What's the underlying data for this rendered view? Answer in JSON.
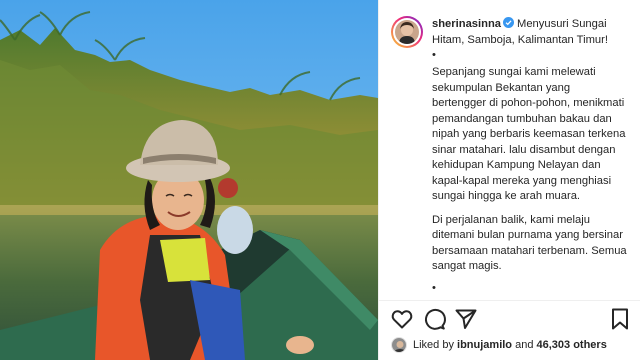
{
  "post": {
    "username": "sherinasinna",
    "caption_title": "Menyusuri Sungai Hitam, Samboja, Kalimantan Timur!",
    "dot": "•",
    "paragraph_1": "Sepanjang sungai kami melewati sekumpulan Bekantan yang bertengger di pohon-pohon, menikmati pemandangan tumbuhan bakau dan nipah yang berbaris keemasan terkena sinar matahari. lalu disambut dengan kehidupan Kampung Nelayan dan kapal-kapal mereka yang menghiasi sungai hingga ke arah muara.",
    "paragraph_2": "Di perjalanan balik, kami melaju ditemani bulan purnama yang bersinar bersamaan matahari terbenam. Semua sangat magis."
  },
  "likes": {
    "prefix": "Liked by ",
    "user": "ibnujamilo",
    "middle": " and ",
    "count": "46,303 others"
  },
  "icons": {
    "like": "heart-icon",
    "comment": "comment-icon",
    "share": "paper-plane-icon",
    "save": "bookmark-icon",
    "verified": "verified-badge-icon"
  },
  "colors": {
    "verified": "#3897f0",
    "text": "#262626",
    "divider": "#efefef"
  }
}
